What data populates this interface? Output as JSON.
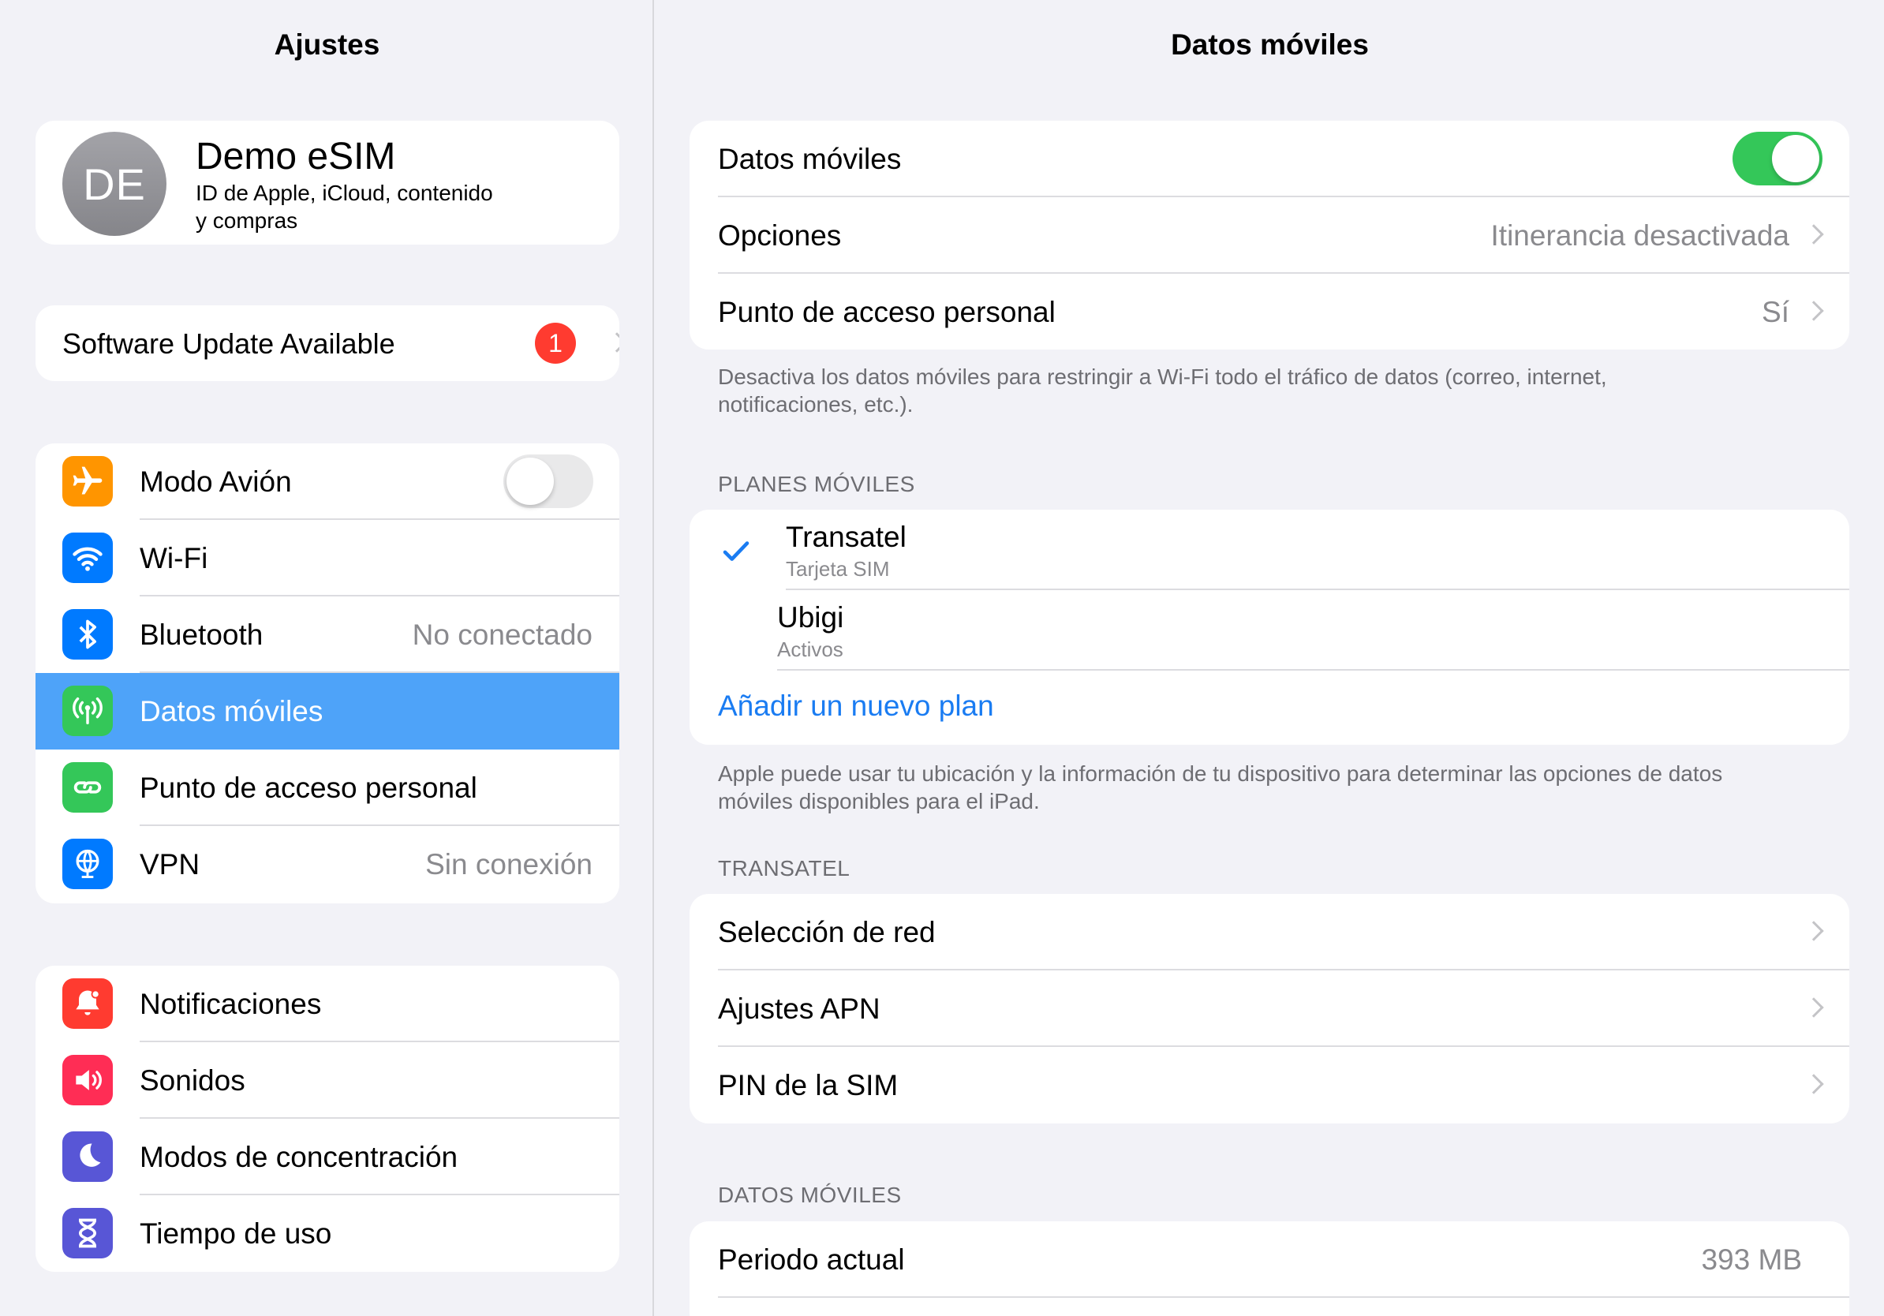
{
  "sidebar": {
    "title": "Ajustes",
    "profile": {
      "initials": "DE",
      "name": "Demo eSIM",
      "subtitle_line1": "ID de Apple, iCloud, contenido",
      "subtitle_line2": "y compras"
    },
    "update": {
      "label": "Software Update Available",
      "badge": "1"
    },
    "group1": [
      {
        "label": "Modo Avión",
        "icon": "airplane-icon",
        "color": "#ff9500",
        "toggle": "off"
      },
      {
        "label": "Wi-Fi",
        "icon": "wifi-icon",
        "color": "#007aff",
        "value": ""
      },
      {
        "label": "Bluetooth",
        "icon": "bluetooth-icon",
        "color": "#007aff",
        "value": "No conectado"
      },
      {
        "label": "Datos móviles",
        "icon": "antenna-icon",
        "color": "#34c759",
        "selected": true
      },
      {
        "label": "Punto de acceso personal",
        "icon": "hotspot-link-icon",
        "color": "#34c759",
        "value": ""
      },
      {
        "label": "VPN",
        "icon": "globe-icon",
        "color": "#007aff",
        "value": "Sin conexión"
      }
    ],
    "group2": [
      {
        "label": "Notificaciones",
        "icon": "bell-icon",
        "color": "#ff3b30"
      },
      {
        "label": "Sonidos",
        "icon": "speaker-icon",
        "color": "#ff2d55"
      },
      {
        "label": "Modos de concentración",
        "icon": "moon-icon",
        "color": "#5856d6"
      },
      {
        "label": "Tiempo de uso",
        "icon": "hourglass-icon",
        "color": "#5856d6"
      }
    ]
  },
  "detail": {
    "title": "Datos móviles",
    "main": {
      "mobile_data_label": "Datos móviles",
      "mobile_data_toggle": "on",
      "options_label": "Opciones",
      "options_value": "Itinerancia desactivada",
      "hotspot_label": "Punto de acceso personal",
      "hotspot_value": "Sí"
    },
    "main_note_line1": "Desactiva los datos móviles para restringir a Wi-Fi todo el tráfico de datos (correo, internet,",
    "main_note_line2": "notificaciones, etc.).",
    "plans_header": "PLANES MÓVILES",
    "plans": [
      {
        "name": "Transatel",
        "sub": "Tarjeta SIM",
        "checked": true
      },
      {
        "name": "Ubigi",
        "sub": "Activos",
        "checked": false
      }
    ],
    "add_plan": "Añadir un nuevo plan",
    "plans_note_line1": "Apple puede usar tu ubicación y la información de tu dispositivo para determinar las opciones de datos",
    "plans_note_line2": "móviles disponibles para el iPad.",
    "carrier_header": "TRANSATEL",
    "carrier_rows": [
      "Selección de red",
      "Ajustes APN",
      "PIN de la SIM"
    ],
    "usage_header": "DATOS MÓVILES",
    "usage": {
      "label": "Periodo actual",
      "value": "393 MB"
    },
    "accent": "#1a7cf2"
  }
}
